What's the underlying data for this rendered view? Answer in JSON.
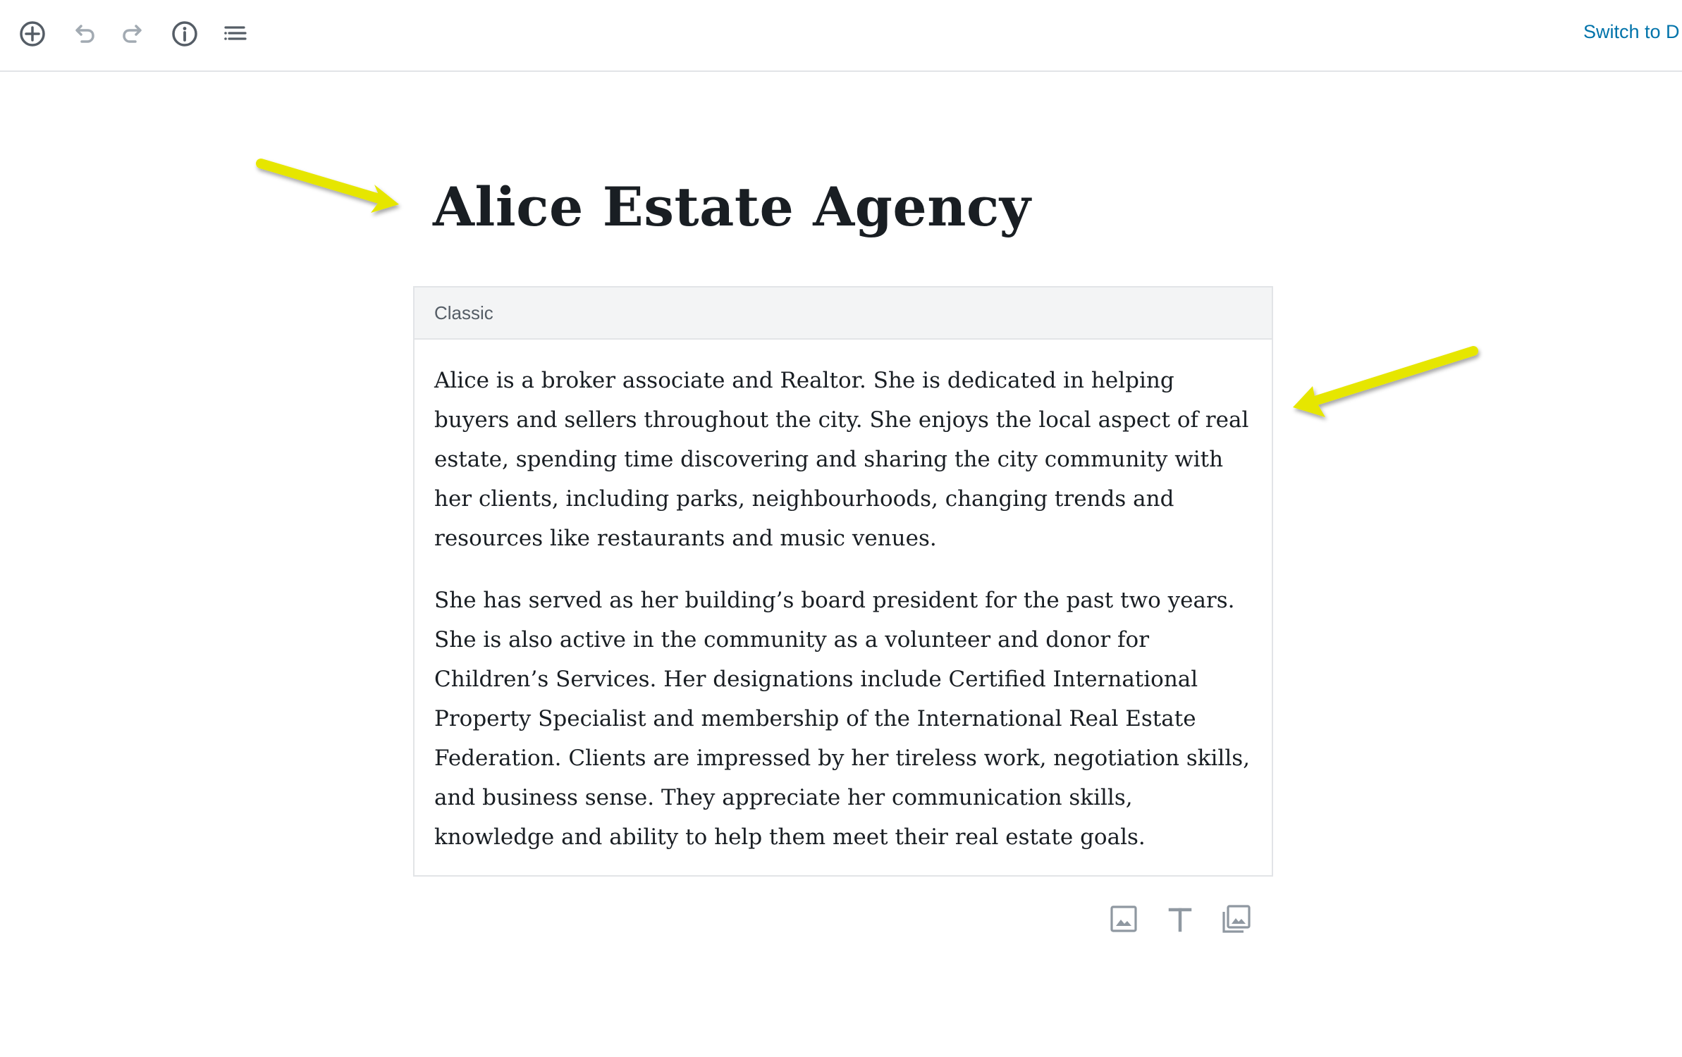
{
  "toolbar": {
    "add_block_icon": "plus-circle-icon",
    "undo_icon": "undo-icon",
    "redo_icon": "redo-icon",
    "info_icon": "info-icon",
    "outline_icon": "list-outline-icon",
    "switch_label": "Switch to D"
  },
  "post": {
    "title": "Alice Estate Agency"
  },
  "classic_block": {
    "label": "Classic",
    "paragraphs": [
      "Alice is a broker associate and Realtor. She is dedicated in helping buyers and sellers throughout the city. She enjoys the local aspect of real estate, spending time discovering and sharing the city community with her clients, including parks, neighbourhoods, changing trends and resources like restaurants and music venues.",
      "She has served as her building’s board president for the past two years. She is also active in the community as a volunteer and donor for Children’s Services. Her designations include Certified International Property Specialist and membership of the International Real Estate Federation. Clients are impressed by her tireless work, negotiation skills, and business sense. They appreciate her communication skills, knowledge and ability to help them meet their real estate goals."
    ]
  },
  "shortcuts": {
    "image_icon": "image-icon",
    "heading_icon": "heading-text-icon",
    "gallery_icon": "gallery-icon"
  },
  "colors": {
    "link": "#0073aa",
    "annotation_arrow": "#e6e600",
    "toolbar_icon": "#555d66",
    "toolbar_icon_disabled": "#a2aab2"
  }
}
